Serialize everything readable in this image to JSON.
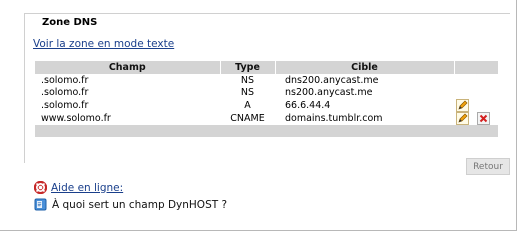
{
  "zone": {
    "legend": "Zone DNS",
    "view_text_link": "Voir la zone en mode texte"
  },
  "table": {
    "headers": [
      "Champ",
      "Type",
      "Cible"
    ],
    "rows": [
      {
        "champ": ".solomo.fr",
        "type": "NS",
        "cible": "dns200.anycast.me",
        "edit": false,
        "delete": false
      },
      {
        "champ": ".solomo.fr",
        "type": "NS",
        "cible": "ns200.anycast.me",
        "edit": false,
        "delete": false
      },
      {
        "champ": ".solomo.fr",
        "type": "A",
        "cible": "66.6.44.4",
        "edit": true,
        "delete": false
      },
      {
        "champ": "www.solomo.fr",
        "type": "CNAME",
        "cible": "domains.tumblr.com",
        "edit": true,
        "delete": true
      }
    ]
  },
  "buttons": {
    "retour": "Retour"
  },
  "help": {
    "aide_label": "Aide en ligne:",
    "dynhost_text": "À quoi sert un champ DynHOST ?"
  },
  "icons": {
    "edit": "pencil-icon",
    "delete": "delete-icon",
    "help": "lifebuoy-icon",
    "info": "info-book-icon"
  },
  "colors": {
    "link": "#1a3f8b",
    "header_bg": "#d4d4d4",
    "delete_red": "#d32020"
  }
}
